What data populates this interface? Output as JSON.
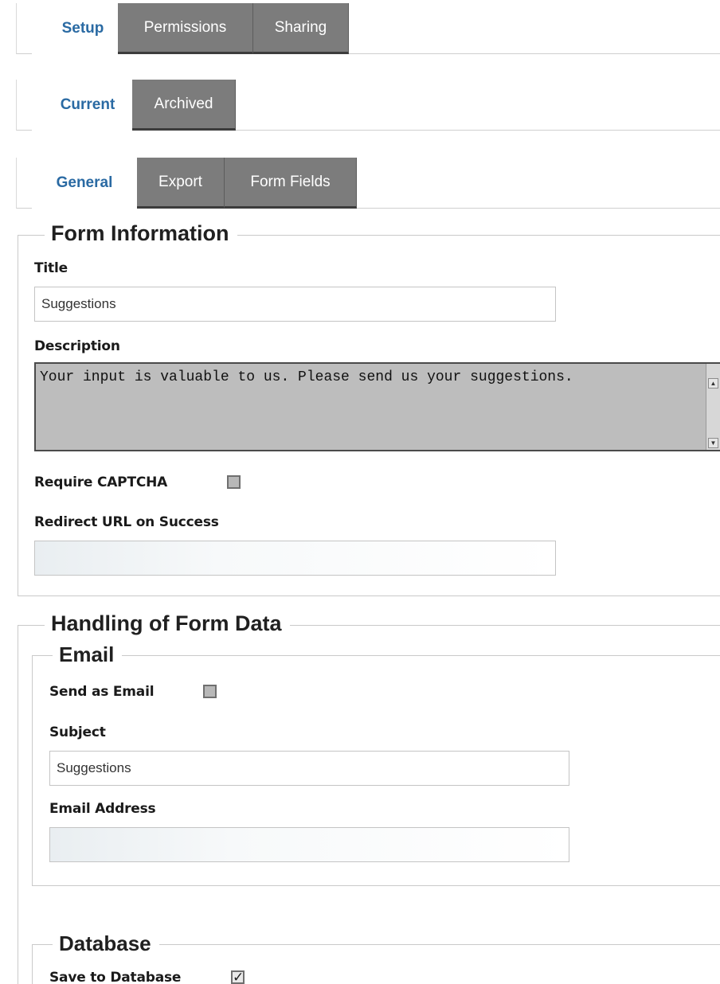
{
  "tabs_top": {
    "setup": "Setup",
    "permissions": "Permissions",
    "sharing": "Sharing"
  },
  "tabs_mid": {
    "current": "Current",
    "archived": "Archived"
  },
  "tabs_sub": {
    "general": "General",
    "export": "Export",
    "form_fields": "Form Fields"
  },
  "form_info": {
    "legend": "Form Information",
    "title_label": "Title",
    "title_value": "Suggestions",
    "description_label": "Description",
    "description_value": "Your input is valuable to us. Please send us your suggestions.",
    "captcha_label": "Require CAPTCHA",
    "redirect_label": "Redirect URL on Success",
    "redirect_value": ""
  },
  "handling": {
    "legend": "Handling of Form Data",
    "email": {
      "legend": "Email",
      "send_label": "Send as Email",
      "subject_label": "Subject",
      "subject_value": "Suggestions",
      "address_label": "Email Address",
      "address_value": ""
    },
    "database": {
      "legend": "Database",
      "save_label": "Save to Database",
      "save_checked": true
    }
  },
  "icons": {
    "scroll_up": "scroll-up-arrow-icon",
    "scroll_down": "scroll-down-arrow-icon",
    "check": "checkmark-icon"
  }
}
